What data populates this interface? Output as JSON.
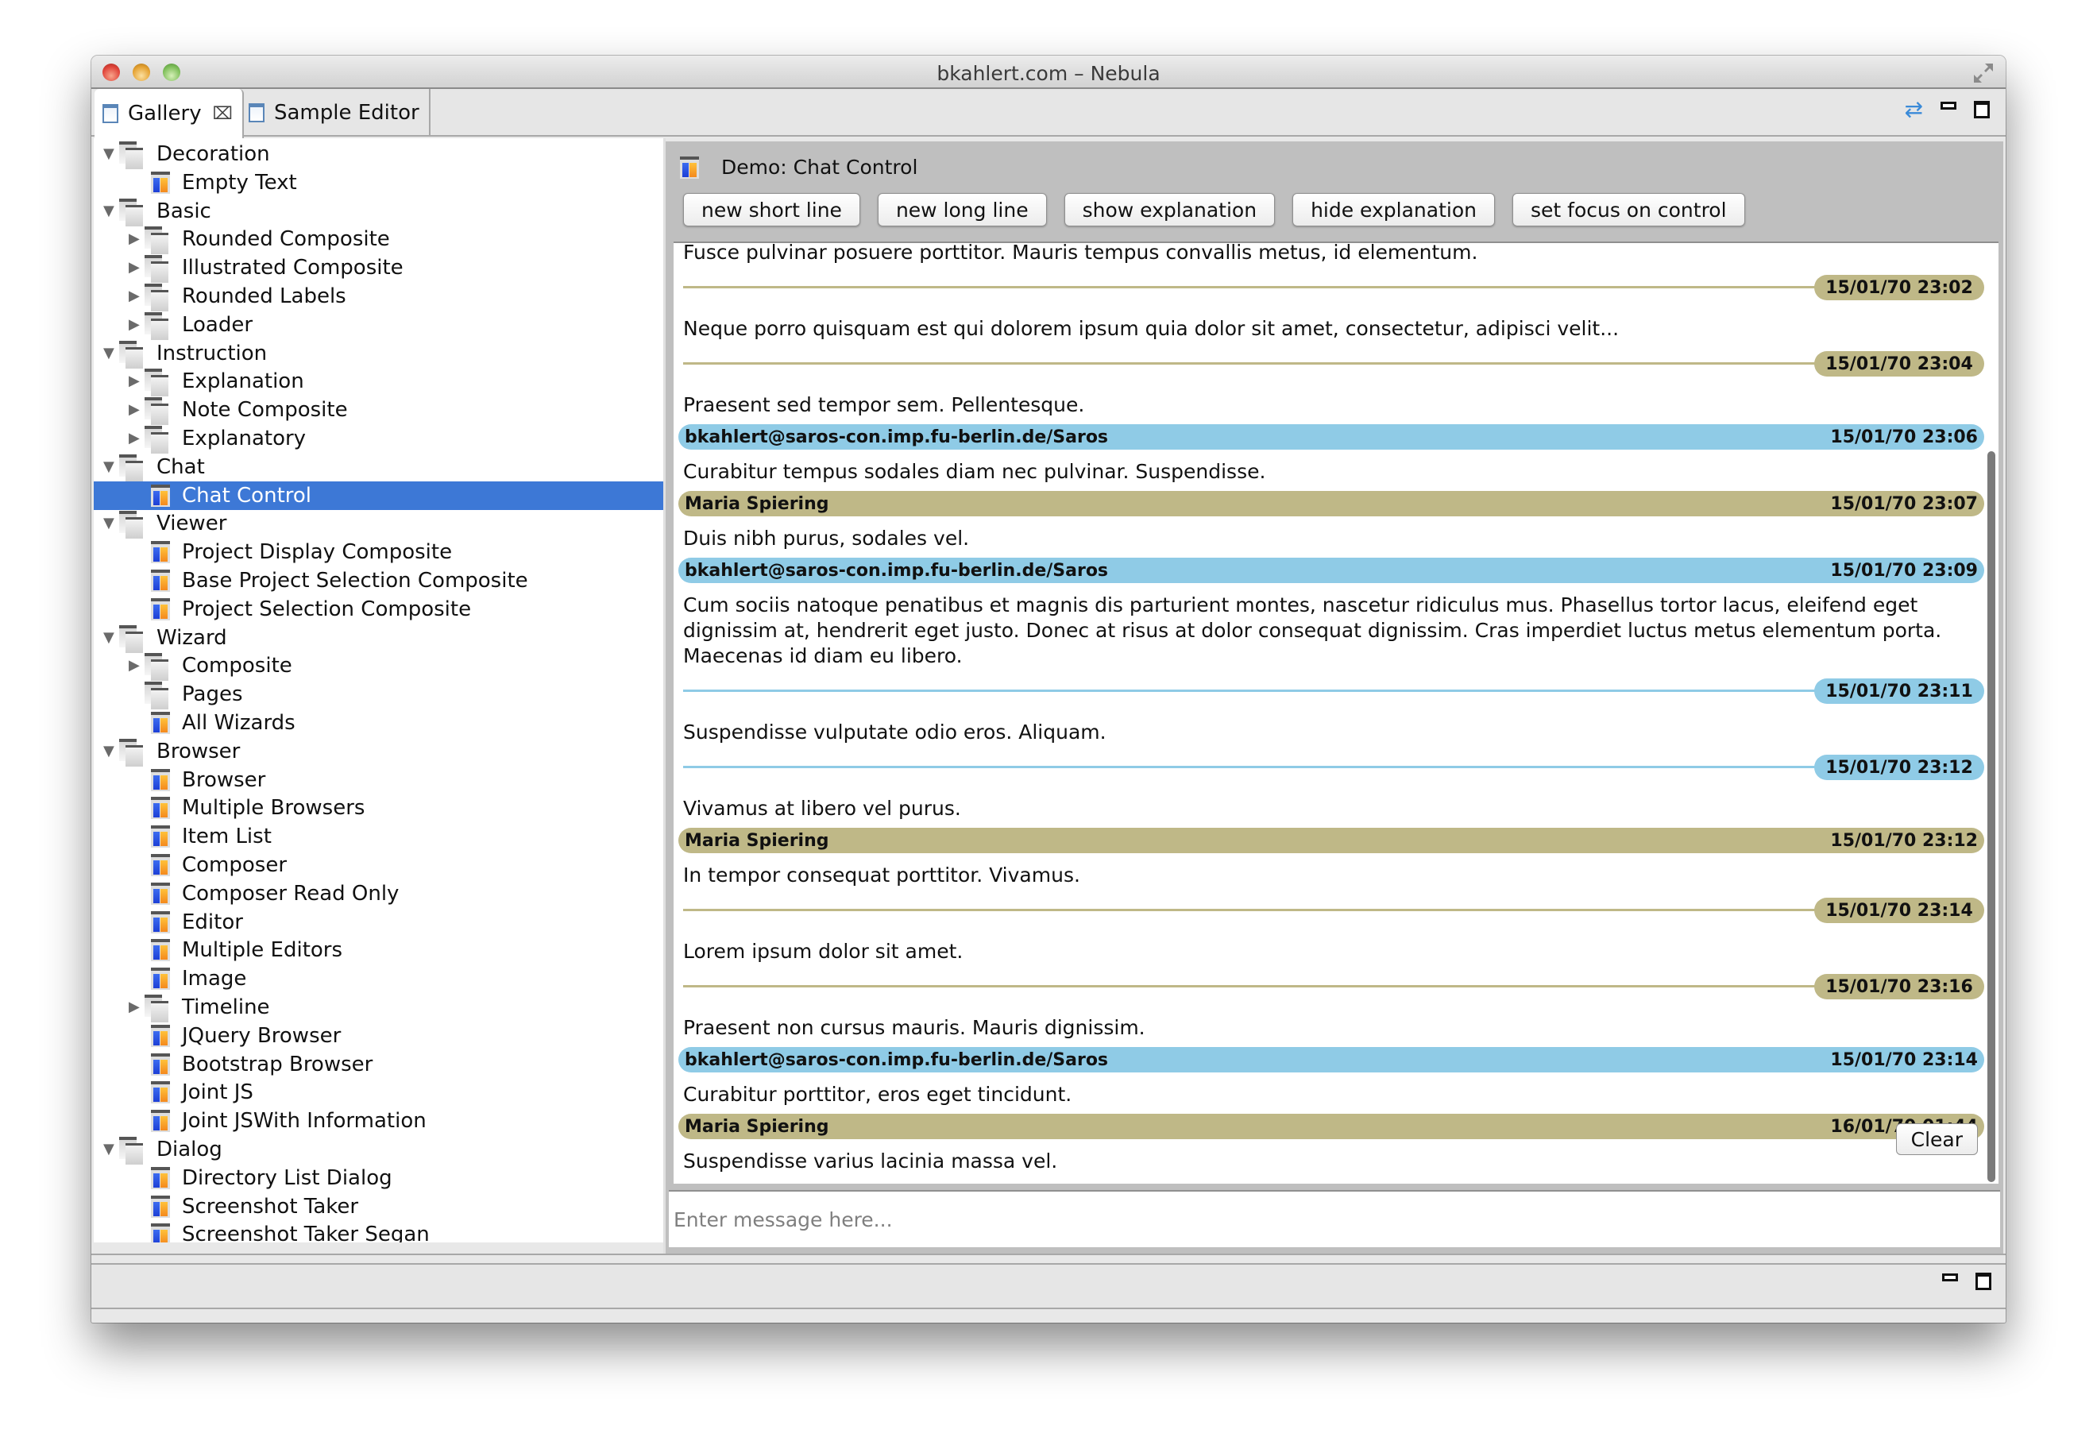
{
  "window": {
    "title": "bkahlert.com – Nebula"
  },
  "tabs": [
    {
      "label": "Gallery",
      "active": true,
      "closable": true
    },
    {
      "label": "Sample Editor",
      "active": false,
      "closable": false
    }
  ],
  "view_toolbar": {
    "sync_icon": "sync-icon",
    "minimize_icon": "minimize-icon",
    "maximize_icon": "maximize-icon"
  },
  "tree": [
    {
      "label": "Decoration",
      "level": 0,
      "type": "folder",
      "expanded": true
    },
    {
      "label": "Empty Text",
      "level": 1,
      "type": "demo"
    },
    {
      "label": "Basic",
      "level": 0,
      "type": "folder",
      "expanded": true
    },
    {
      "label": "Rounded Composite",
      "level": 1,
      "type": "folder",
      "expanded": false
    },
    {
      "label": "Illustrated Composite",
      "level": 1,
      "type": "folder",
      "expanded": false
    },
    {
      "label": "Rounded Labels",
      "level": 1,
      "type": "folder",
      "expanded": false
    },
    {
      "label": "Loader",
      "level": 1,
      "type": "folder",
      "expanded": false
    },
    {
      "label": "Instruction",
      "level": 0,
      "type": "folder",
      "expanded": true
    },
    {
      "label": "Explanation",
      "level": 1,
      "type": "folder",
      "expanded": false
    },
    {
      "label": "Note Composite",
      "level": 1,
      "type": "folder",
      "expanded": false
    },
    {
      "label": "Explanatory",
      "level": 1,
      "type": "folder",
      "expanded": false
    },
    {
      "label": "Chat",
      "level": 0,
      "type": "folder",
      "expanded": true
    },
    {
      "label": "Chat Control",
      "level": 1,
      "type": "demo",
      "selected": true
    },
    {
      "label": "Viewer",
      "level": 0,
      "type": "folder",
      "expanded": true
    },
    {
      "label": "Project Display Composite",
      "level": 1,
      "type": "demo"
    },
    {
      "label": "Base Project Selection Composite",
      "level": 1,
      "type": "demo"
    },
    {
      "label": "Project Selection Composite",
      "level": 1,
      "type": "demo"
    },
    {
      "label": "Wizard",
      "level": 0,
      "type": "folder",
      "expanded": true
    },
    {
      "label": "Composite",
      "level": 1,
      "type": "folder",
      "expanded": false
    },
    {
      "label": "Pages",
      "level": 1,
      "type": "folder",
      "leaf": true
    },
    {
      "label": "All Wizards",
      "level": 1,
      "type": "demo"
    },
    {
      "label": "Browser",
      "level": 0,
      "type": "folder",
      "expanded": true
    },
    {
      "label": "Browser",
      "level": 1,
      "type": "demo"
    },
    {
      "label": "Multiple Browsers",
      "level": 1,
      "type": "demo"
    },
    {
      "label": "Item List",
      "level": 1,
      "type": "demo"
    },
    {
      "label": "Composer",
      "level": 1,
      "type": "demo"
    },
    {
      "label": "Composer Read Only",
      "level": 1,
      "type": "demo"
    },
    {
      "label": "Editor",
      "level": 1,
      "type": "demo"
    },
    {
      "label": "Multiple Editors",
      "level": 1,
      "type": "demo"
    },
    {
      "label": "Image",
      "level": 1,
      "type": "demo"
    },
    {
      "label": "Timeline",
      "level": 1,
      "type": "folder",
      "expanded": false
    },
    {
      "label": "JQuery Browser",
      "level": 1,
      "type": "demo"
    },
    {
      "label": "Bootstrap Browser",
      "level": 1,
      "type": "demo"
    },
    {
      "label": "Joint JS",
      "level": 1,
      "type": "demo"
    },
    {
      "label": "Joint JSWith Information",
      "level": 1,
      "type": "demo"
    },
    {
      "label": "Dialog",
      "level": 0,
      "type": "folder",
      "expanded": true
    },
    {
      "label": "Directory List Dialog",
      "level": 1,
      "type": "demo"
    },
    {
      "label": "Screenshot Taker",
      "level": 1,
      "type": "demo"
    },
    {
      "label": "Screenshot Taker Segan",
      "level": 1,
      "type": "demo"
    }
  ],
  "demo": {
    "title": "Demo: Chat Control",
    "buttons": [
      "new short line",
      "new long line",
      "show explanation",
      "hide explanation",
      "set focus on control"
    ],
    "clear_label": "Clear",
    "input_placeholder": "Enter message here...",
    "input_value": ""
  },
  "colors": {
    "blue": "#8fcbe6",
    "olive": "#bfb887",
    "selection": "#3d78d6"
  },
  "chat": [
    {
      "kind": "text",
      "text": "Fusce pulvinar posuere porttitor. Mauris tempus convallis metus, id elementum."
    },
    {
      "kind": "sep",
      "color": "olive",
      "time": "15/01/70 23:02"
    },
    {
      "kind": "text",
      "text": "Neque porro quisquam est qui dolorem ipsum quia dolor sit amet, consectetur, adipisci velit..."
    },
    {
      "kind": "sep",
      "color": "olive",
      "time": "15/01/70 23:04"
    },
    {
      "kind": "text",
      "text": "Praesent sed tempor sem. Pellentesque."
    },
    {
      "kind": "header",
      "color": "blue",
      "sender": "bkahlert@saros-con.imp.fu-berlin.de/Saros",
      "time": "15/01/70 23:06"
    },
    {
      "kind": "text",
      "text": "Curabitur tempus sodales diam nec pulvinar. Suspendisse."
    },
    {
      "kind": "header",
      "color": "olive",
      "sender": "Maria Spiering",
      "time": "15/01/70 23:07"
    },
    {
      "kind": "text",
      "text": "Duis nibh purus, sodales vel."
    },
    {
      "kind": "header",
      "color": "blue",
      "sender": "bkahlert@saros-con.imp.fu-berlin.de/Saros",
      "time": "15/01/70 23:09"
    },
    {
      "kind": "text",
      "text": "Cum sociis natoque penatibus et magnis dis parturient montes, nascetur ridiculus mus. Phasellus tortor lacus, eleifend eget dignissim at, hendrerit eget justo. Donec at risus at dolor consequat dignissim. Cras imperdiet luctus metus elementum porta. Maecenas id diam eu libero."
    },
    {
      "kind": "sep",
      "color": "blue",
      "time": "15/01/70 23:11"
    },
    {
      "kind": "text",
      "text": "Suspendisse vulputate odio eros. Aliquam."
    },
    {
      "kind": "sep",
      "color": "blue",
      "time": "15/01/70 23:12"
    },
    {
      "kind": "text",
      "text": "Vivamus at libero vel purus."
    },
    {
      "kind": "header",
      "color": "olive",
      "sender": "Maria Spiering",
      "time": "15/01/70 23:12"
    },
    {
      "kind": "text",
      "text": "In tempor consequat porttitor. Vivamus."
    },
    {
      "kind": "sep",
      "color": "olive",
      "time": "15/01/70 23:14"
    },
    {
      "kind": "text",
      "text": "Lorem ipsum dolor sit amet."
    },
    {
      "kind": "sep",
      "color": "olive",
      "time": "15/01/70 23:16"
    },
    {
      "kind": "text",
      "text": "Praesent non cursus mauris. Mauris dignissim."
    },
    {
      "kind": "header",
      "color": "blue",
      "sender": "bkahlert@saros-con.imp.fu-berlin.de/Saros",
      "time": "15/01/70 23:14"
    },
    {
      "kind": "text",
      "text": "Curabitur porttitor, eros eget tincidunt."
    },
    {
      "kind": "header",
      "color": "olive",
      "sender": "Maria Spiering",
      "time": "16/01/70 01:44"
    },
    {
      "kind": "text",
      "text": "Suspendisse varius lacinia massa vel."
    }
  ]
}
